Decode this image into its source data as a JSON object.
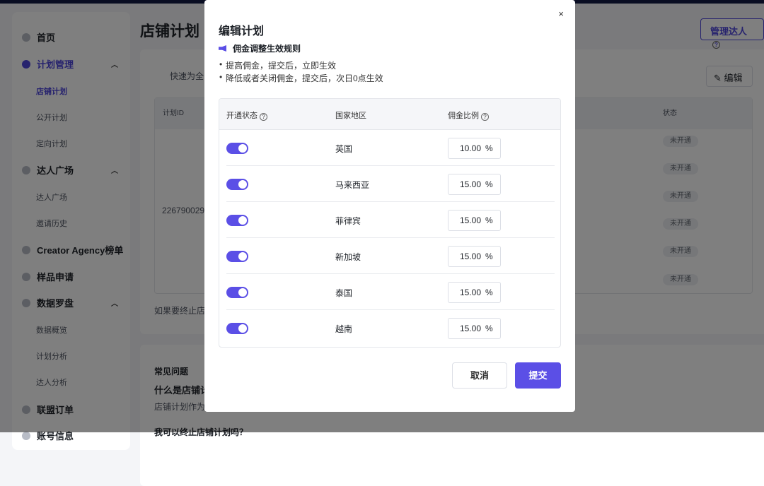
{
  "sidebar": {
    "items": [
      {
        "label": "首页"
      },
      {
        "label": "计划管理",
        "sub": [
          "店铺计划",
          "公开计划",
          "定向计划"
        ]
      },
      {
        "label": "达人广场",
        "sub": [
          "达人广场",
          "邀请历史"
        ]
      },
      {
        "label": "Creator Agency榜单"
      },
      {
        "label": "样品申请"
      },
      {
        "label": "数据罗盘",
        "sub": [
          "数据概览",
          "计划分析",
          "达人分析"
        ]
      },
      {
        "label": "联盟订单"
      },
      {
        "label": "账号信息"
      }
    ]
  },
  "page": {
    "title": "店铺计划",
    "manage_btn": "管理达人",
    "notice": "快速为全",
    "edit_btn": "编辑",
    "col_id": "计划ID",
    "col_status": "状态",
    "plan_id": "226790029",
    "footer_note": "如果要终止店",
    "statuses": [
      "未开通",
      "未开通",
      "未开通",
      "未开通",
      "未开通",
      "未开通"
    ],
    "faq_title": "常见问题",
    "faq_q1": "什么是店铺计",
    "faq_a1": "店铺计划作为",
    "faq_q2": "我可以终止店铺计划吗？"
  },
  "dialog": {
    "title": "编辑计划",
    "close": "×",
    "rule_title": "佣金调整生效规则",
    "rules": [
      "提高佣金，提交后，立即生效",
      "降低或者关闭佣金，提交后，次日0点生效"
    ],
    "headers": {
      "status": "开通状态",
      "region": "国家地区",
      "rate": "佣金比例"
    },
    "rows": [
      {
        "region": "英国",
        "rate": "10.00",
        "on": true
      },
      {
        "region": "马来西亚",
        "rate": "15.00",
        "on": true
      },
      {
        "region": "菲律宾",
        "rate": "15.00",
        "on": true
      },
      {
        "region": "新加坡",
        "rate": "15.00",
        "on": true
      },
      {
        "region": "泰国",
        "rate": "15.00",
        "on": true
      },
      {
        "region": "越南",
        "rate": "15.00",
        "on": true
      }
    ],
    "percent": "%",
    "cancel": "取消",
    "submit": "提交"
  },
  "colors": {
    "accent": "#5b4fe6",
    "topbar": "#121a44"
  }
}
